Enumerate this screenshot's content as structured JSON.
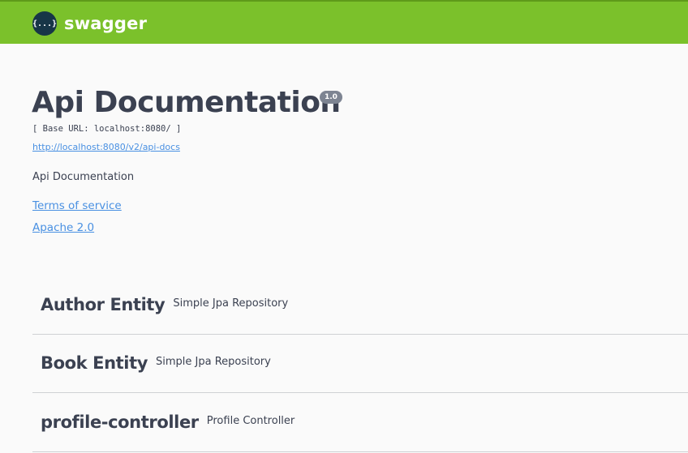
{
  "header": {
    "logo_icon": "{...}",
    "logo_text": "swagger",
    "brand_color": "#7bc12b"
  },
  "info": {
    "title": "Api Documentation",
    "version": "1.0",
    "base_url": "[ Base URL: localhost:8080/ ]",
    "docs_url": "http://localhost:8080/v2/api-docs",
    "description": "Api Documentation",
    "terms_label": "Terms of service",
    "license_label": "Apache 2.0"
  },
  "tags": [
    {
      "name": "Author Entity",
      "description": "Simple Jpa Repository"
    },
    {
      "name": "Book Entity",
      "description": "Simple Jpa Repository"
    },
    {
      "name": "profile-controller",
      "description": "Profile Controller"
    }
  ]
}
